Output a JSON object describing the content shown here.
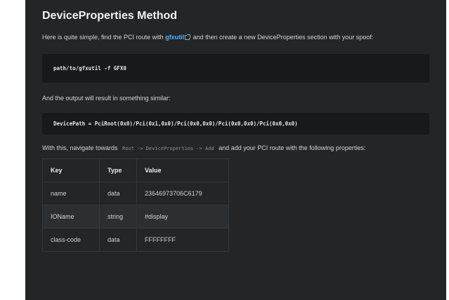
{
  "section": {
    "heading": "DeviceProperties Method",
    "intro_before_link": "Here is quite simple, find the PCI route with ",
    "link_text": "gfxutil",
    "intro_after_link": " and then create a new DeviceProperties section with your spoof:",
    "command": "path/to/gfxutil -f GFX0",
    "output_intro": "And the output will result in something similar:",
    "output": "DevicePath = PciRoot(0x0)/Pci(0x1,0x0)/Pci(0x0,0x0)/Pci(0x0,0x0)/Pci(0x0,0x0)",
    "navigate_before": "With this, navigate towards ",
    "navigate_code": "Root -> DeviceProperties -> Add",
    "navigate_after": " and add your PCI route with the following properties:"
  },
  "table": {
    "headers": [
      "Key",
      "Type",
      "Value"
    ],
    "rows": [
      [
        "name",
        "data",
        "23646973706C6179"
      ],
      [
        "IOName",
        "string",
        "#display"
      ],
      [
        "class-code",
        "data",
        "FFFFFFFF"
      ]
    ]
  },
  "icons": {
    "link_icon": "external-link-icon"
  },
  "colors": {
    "panel_background": "#232527",
    "code_background": "#18191b",
    "link": "#4fb3ff"
  }
}
